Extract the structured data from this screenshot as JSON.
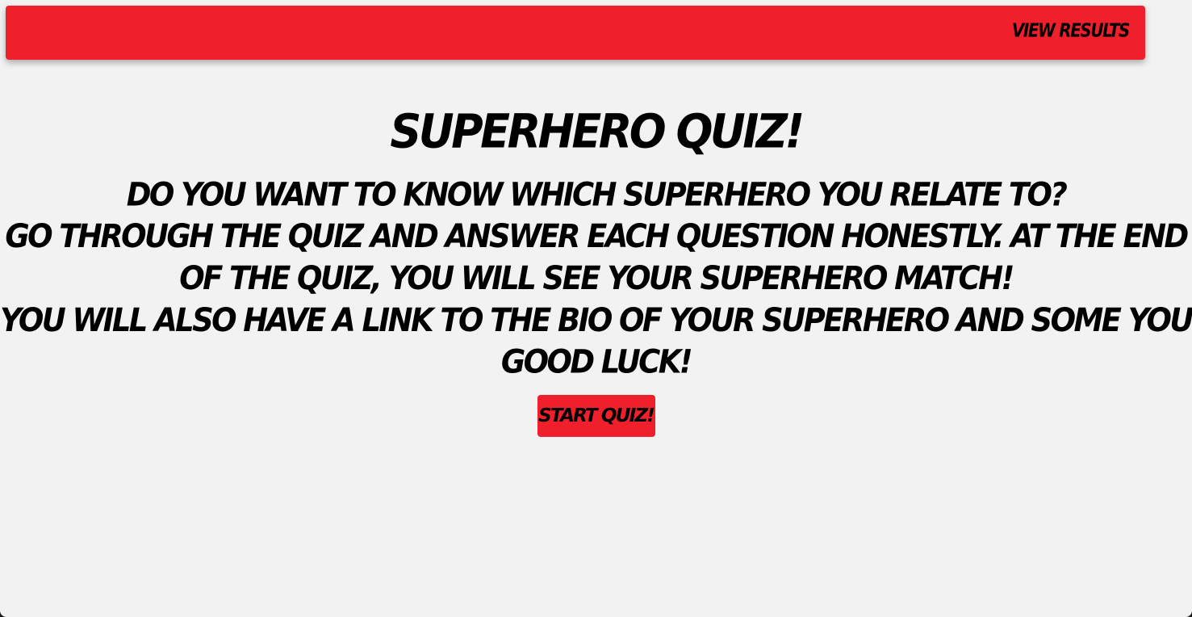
{
  "nav": {
    "view_results": "View Results"
  },
  "main": {
    "title": "Superhero Quiz!",
    "intro_lines": [
      "Do you want to know which superhero you relate to?",
      "Go through the quiz and answer each question honestly. At the end of the quiz, you will see your superhero match!",
      "You will also have a link to the bio of your superhero and some youtube videos!",
      "Good Luck!"
    ],
    "start_button": "Start Quiz!"
  },
  "colors": {
    "accent": "#ef1f2b",
    "background": "#f2f2f2",
    "text": "#000000"
  }
}
